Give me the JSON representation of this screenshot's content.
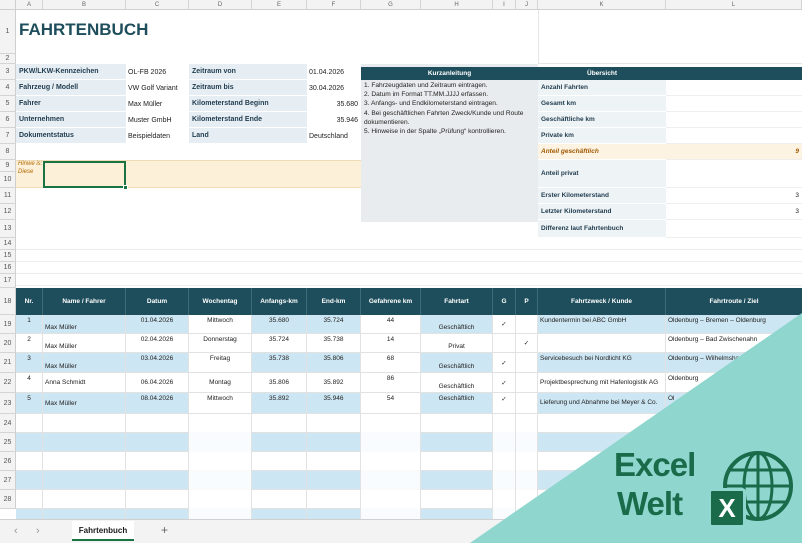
{
  "columns": [
    "A",
    "B",
    "C",
    "D",
    "E",
    "F",
    "G",
    "H",
    "I",
    "J",
    "K",
    "L"
  ],
  "rows": [
    "1",
    "2",
    "3",
    "4",
    "5",
    "6",
    "7",
    "8",
    "9",
    "10",
    "11",
    "12",
    "13",
    "14",
    "15",
    "16",
    "17",
    "18",
    "19",
    "20",
    "21",
    "22",
    "23",
    "24",
    "25",
    "26",
    "27",
    "28"
  ],
  "title": "FAHRTENBUCH",
  "info_left": [
    {
      "label": "PKW/LKW-Kennzeichen",
      "value": "OL-FB 2026"
    },
    {
      "label": "Fahrzeug / Modell",
      "value": "VW Golf Variant"
    },
    {
      "label": "Fahrer",
      "value": "Max Müller"
    },
    {
      "label": "Unternehmen",
      "value": "Muster GmbH"
    },
    {
      "label": "Dokumentstatus",
      "value": "Beispieldaten"
    }
  ],
  "info_right": [
    {
      "label": "Zeitraum von",
      "value": "01.04.2026"
    },
    {
      "label": "Zeitraum bis",
      "value": "30.04.2026"
    },
    {
      "label": "Kilometerstand Beginn",
      "value": "35.680"
    },
    {
      "label": "Kilometerstand Ende",
      "value": "35.946"
    },
    {
      "label": "Land",
      "value": "Deutschland"
    }
  ],
  "hint_text": "Hinwe is: Diese",
  "kurzanleitung": {
    "title": "Kurzanleitung",
    "lines": [
      "1. Fahrzeugdaten und Zeitraum eintragen.",
      "2. Datum im Format TT.MM.JJJJ erfassen.",
      "3. Anfangs- und Endkilometerstand eintragen.",
      "4. Bei geschäftlichen Fahrten Zweck/Kunde und Route dokumentieren.",
      "5. Hinweise in der Spalte „Prüfung“ kontrollieren."
    ]
  },
  "uebersicht": {
    "title": "Übersicht",
    "items": [
      {
        "label": "Anzahl Fahrten",
        "value": ""
      },
      {
        "label": "Gesamt km",
        "value": ""
      },
      {
        "label": "Geschäftliche km",
        "value": ""
      },
      {
        "label": "Private km",
        "value": ""
      },
      {
        "label": "Anteil geschäftlich",
        "value": "9"
      },
      {
        "label": "Anteil privat",
        "value": ""
      },
      {
        "label": "Erster Kilometerstand",
        "value": "3"
      },
      {
        "label": "Letzter Kilometerstand",
        "value": "3"
      },
      {
        "label": "Differenz laut Fahrtenbuch",
        "value": ""
      }
    ]
  },
  "table": {
    "headers": [
      "Nr.",
      "Name / Fahrer",
      "Datum",
      "Wochentag",
      "Anfangs-km",
      "End-km",
      "Gefahrene km",
      "Fahrtart",
      "G",
      "P",
      "Fahrtzweck / Kunde",
      "Fahrtroute / Ziel"
    ],
    "rows": [
      {
        "nr": "1",
        "name": "Max Müller",
        "datum": "01.04.2026",
        "tag": "Mittwoch",
        "start": "35.680",
        "end": "35.724",
        "km": "44",
        "art": "Geschäftlich",
        "g": "✓",
        "p": "",
        "zweck": "Kundentermin bei ABC GmbH",
        "route": "Oldenburg – Bremen – Oldenburg"
      },
      {
        "nr": "2",
        "name": "Max Müller",
        "datum": "02.04.2026",
        "tag": "Donnerstag",
        "start": "35.724",
        "end": "35.738",
        "km": "14",
        "art": "Privat",
        "g": "",
        "p": "✓",
        "zweck": "",
        "route": "Oldenburg – Bad Zwischenahn"
      },
      {
        "nr": "3",
        "name": "Max Müller",
        "datum": "03.04.2026",
        "tag": "Freitag",
        "start": "35.738",
        "end": "35.806",
        "km": "68",
        "art": "Geschäftlich",
        "g": "✓",
        "p": "",
        "zweck": "Servicebesuch bei Nordlicht KG",
        "route": "Oldenburg – Wilhelmshaven"
      },
      {
        "nr": "4",
        "name": "Anna Schmidt",
        "datum": "06.04.2026",
        "tag": "Montag",
        "start": "35.806",
        "end": "35.892",
        "km": "86",
        "art": "Geschäftlich",
        "g": "✓",
        "p": "",
        "zweck": "Projektbesprechung mit Hafenlogistik AG",
        "route": "Oldenburg"
      },
      {
        "nr": "5",
        "name": "Max Müller",
        "datum": "08.04.2026",
        "tag": "Mittwoch",
        "start": "35.892",
        "end": "35.946",
        "km": "54",
        "art": "Geschäftlich",
        "g": "✓",
        "p": "",
        "zweck": "Lieferung und Abnahme bei Meyer & Co.",
        "route": "Ol"
      }
    ]
  },
  "sheet_tab": "Fahrtenbuch",
  "add_sheet": "+",
  "nav_prev": "‹",
  "nav_next": "›",
  "logo": {
    "line1": "Excel",
    "line2": "Welt",
    "badge": "X"
  },
  "colors": {
    "header_dark": "#1e4e5c",
    "row_blue": "#cde6f3",
    "accent_teal": "#8fd6cf",
    "logo_green": "#1a6b4a",
    "hint_bg": "#fdf0d9"
  }
}
